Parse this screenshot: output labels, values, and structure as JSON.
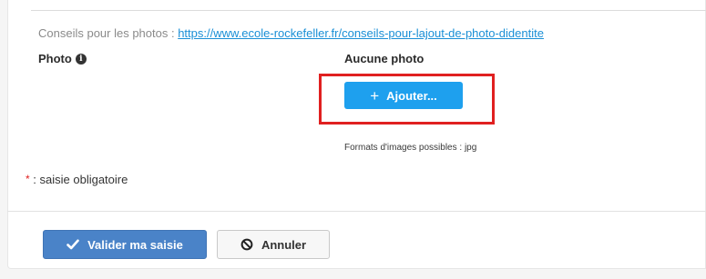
{
  "tips": {
    "prefix": "Conseils pour les photos : ",
    "link": "https://www.ecole-rockefeller.fr/conseils-pour-lajout-de-photo-didentite"
  },
  "photo": {
    "label": "Photo",
    "status": "Aucune photo",
    "add_button_label": "Ajouter...",
    "formats": "Formats d'images possibles : jpg"
  },
  "form": {
    "required_star": "*",
    "required_note": " : saisie obligatoire"
  },
  "actions": {
    "validate_label": "Valider ma saisie",
    "cancel_label": "Annuler"
  },
  "colors": {
    "link": "#1a8fd6",
    "add_button": "#1ea0ee",
    "highlight": "#e02020",
    "validate_button": "#4a83c8"
  }
}
